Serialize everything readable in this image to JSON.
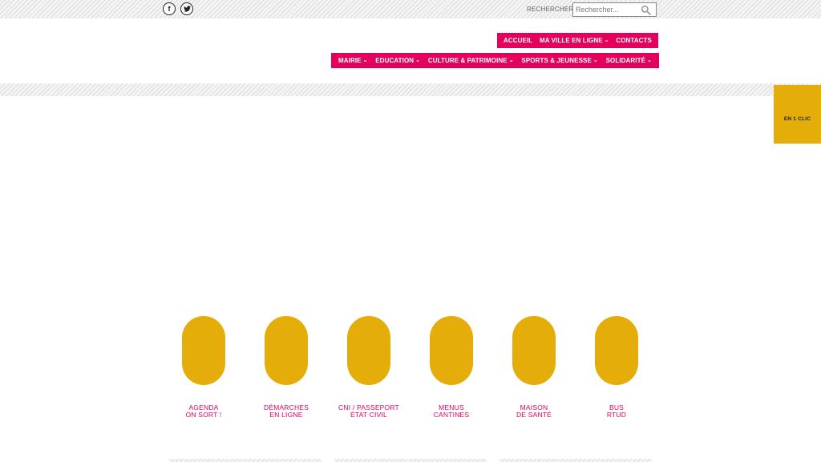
{
  "social": {
    "facebook_icon": "facebook-icon",
    "twitter_icon": "twitter-icon"
  },
  "search": {
    "label": "RECHERCHER",
    "placeholder": "Rechercher..."
  },
  "nav_top": [
    {
      "label": "ACCUEIL",
      "dropdown": false
    },
    {
      "label": "MA VILLE EN LIGNE",
      "dropdown": true
    },
    {
      "label": "CONTACTS",
      "dropdown": false
    }
  ],
  "nav_main": [
    {
      "label": "MAIRIE",
      "dropdown": true
    },
    {
      "label": "EDUCATION",
      "dropdown": true
    },
    {
      "label": "CULTURE & PATRIMOINE",
      "dropdown": true
    },
    {
      "label": "SPORTS & JEUNESSE",
      "dropdown": true
    },
    {
      "label": "SOLIDARITÉ",
      "dropdown": true
    }
  ],
  "side_tab": {
    "label": "EN 1 CLIC"
  },
  "quick_links": [
    {
      "line1": "AGENDA",
      "line2": "ON SORT !"
    },
    {
      "line1": "DÉMARCHES",
      "line2": "EN LIGNE"
    },
    {
      "line1": "CNI / PASSEPORT",
      "line2": "ÉTAT CIVIL"
    },
    {
      "line1": "MENUS",
      "line2": "CANTINES"
    },
    {
      "line1": "MAISON",
      "line2": "DE SANTÉ"
    },
    {
      "line1": "BUS",
      "line2": "RTUD"
    }
  ],
  "colors": {
    "accent_pink": "#e5005b",
    "accent_yellow": "#e5ad0a"
  }
}
